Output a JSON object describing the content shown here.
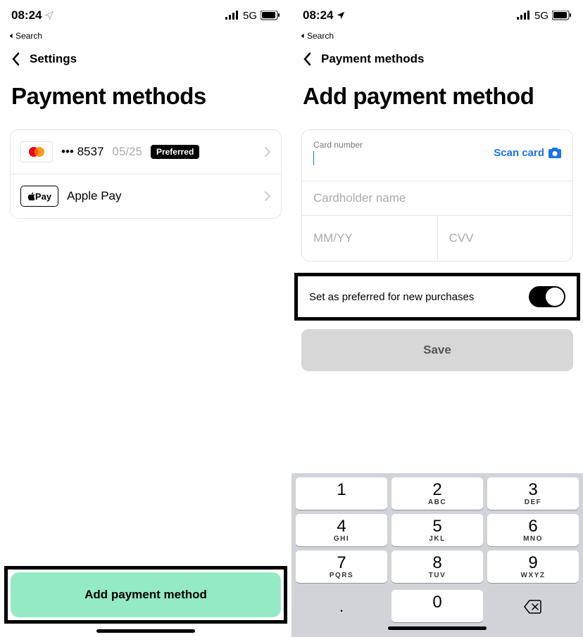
{
  "status": {
    "time": "08:24",
    "net": "5G"
  },
  "breadcrumb_left": "Search",
  "screen1": {
    "back": "Settings",
    "title": "Payment methods",
    "card1": {
      "mask": "••• 8537",
      "exp": "05/25",
      "badge": "Preferred"
    },
    "card2": {
      "label": "Apple Pay",
      "box": "Pay"
    },
    "cta": "Add payment method"
  },
  "screen2": {
    "back": "Payment methods",
    "title": "Add payment method",
    "cardnum_label": "Card number",
    "scan": "Scan card",
    "holder": "Cardholder name",
    "mmyy": "MM/YY",
    "cvv": "CVV",
    "toggle": "Set as preferred for new purchases",
    "save": "Save",
    "keypad": [
      [
        {
          "n": "1",
          "l": ""
        },
        {
          "n": "2",
          "l": "ABC"
        },
        {
          "n": "3",
          "l": "DEF"
        }
      ],
      [
        {
          "n": "4",
          "l": "GHI"
        },
        {
          "n": "5",
          "l": "JKL"
        },
        {
          "n": "6",
          "l": "MNO"
        }
      ],
      [
        {
          "n": "7",
          "l": "PQRS"
        },
        {
          "n": "8",
          "l": "TUV"
        },
        {
          "n": "9",
          "l": "WXYZ"
        }
      ]
    ],
    "dot": ".",
    "zero": "0"
  }
}
